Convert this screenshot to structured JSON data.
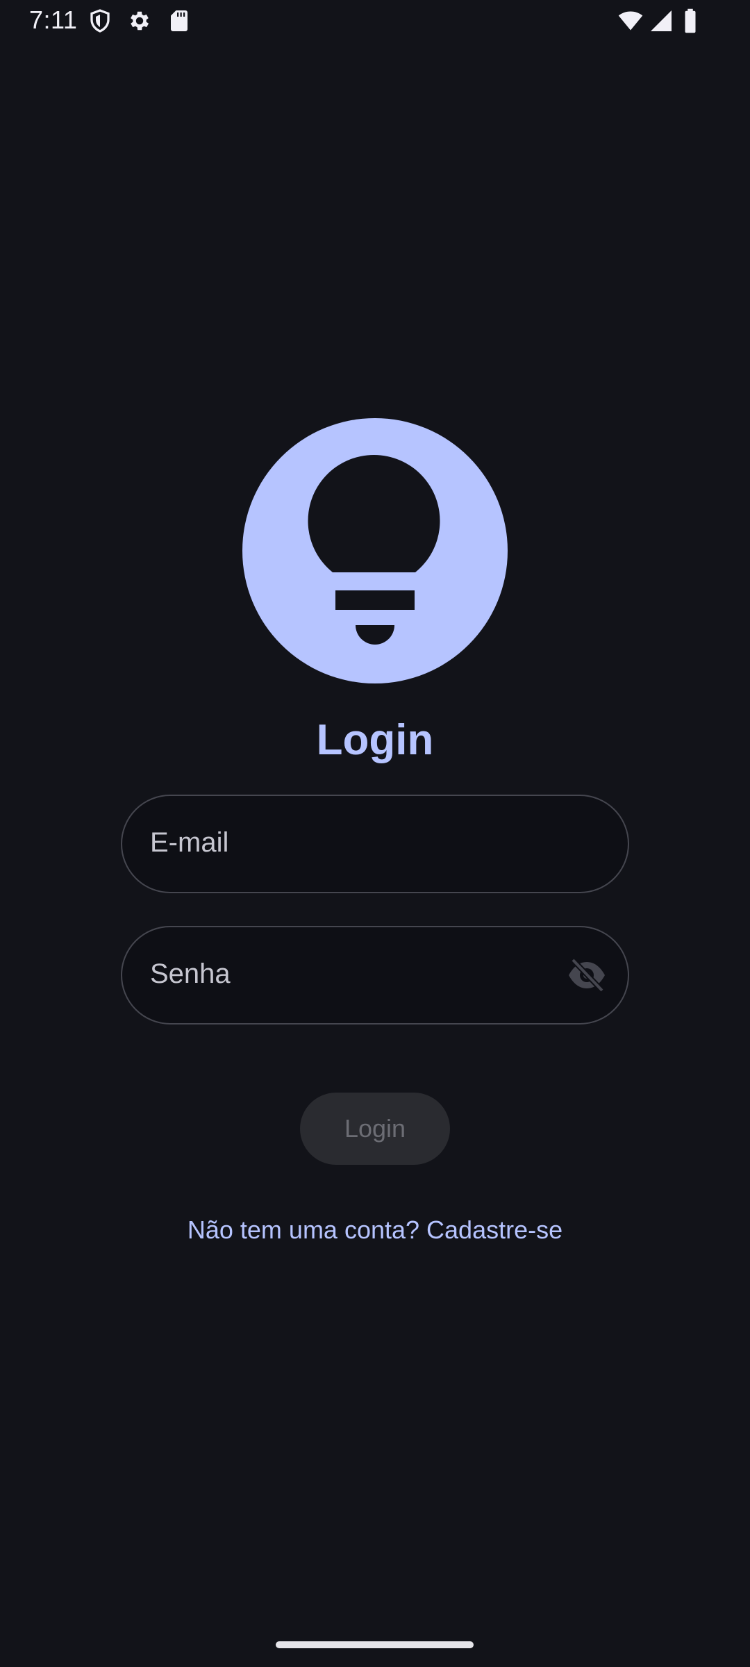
{
  "status_bar": {
    "time": "7:11",
    "left_icons": [
      "shield-icon",
      "settings-gear-icon",
      "sd-card-icon"
    ],
    "right_icons": [
      "wifi-icon",
      "cell-signal-icon",
      "battery-icon"
    ]
  },
  "logo": {
    "icon": "lightbulb-icon",
    "color": "#b6c4ff"
  },
  "title": "Login",
  "form": {
    "email": {
      "placeholder": "E-mail",
      "value": ""
    },
    "password": {
      "placeholder": "Senha",
      "value": "",
      "toggle_icon": "visibility-off-icon"
    },
    "submit_label": "Login"
  },
  "signup_link": "Não tem uma conta? Cadastre-se",
  "colors": {
    "background": "#121319",
    "accent": "#b6c4ff",
    "field_border": "#45464f",
    "button_disabled_bg": "#2a2b30",
    "button_disabled_text": "#6c6d74"
  }
}
